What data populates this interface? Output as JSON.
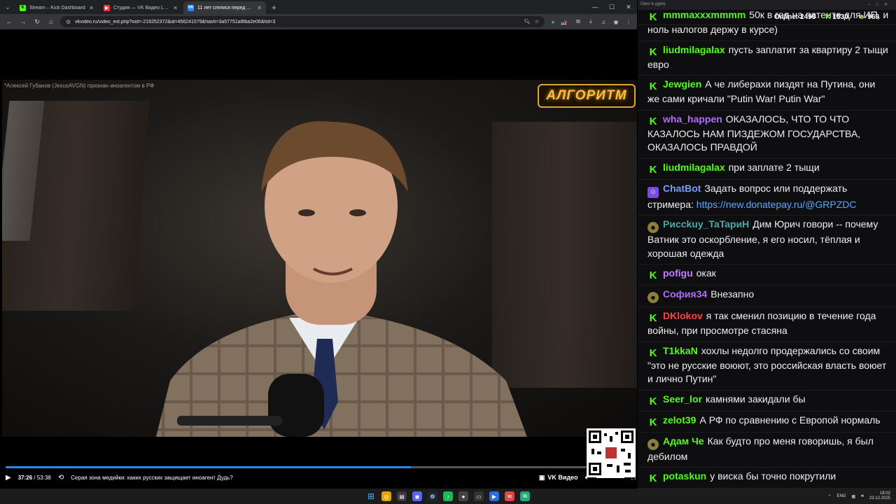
{
  "browser": {
    "tabs": [
      {
        "label": "Stream – Kick Dashboard",
        "color": "#53fc18",
        "glyph": "K"
      },
      {
        "label": "Студия — VK Видео Live",
        "color": "#ff3347",
        "glyph": "V"
      },
      {
        "label": "11 лет сгелися перед Украин",
        "color": "#2787f5",
        "glyph": "VK"
      }
    ],
    "url": "vkvideo.ru/video_ext.php?oid=-219252372&id=456241579&hash=3a57751a9fba2e06&hd=3",
    "ext_badge": "344"
  },
  "video": {
    "notice": "*Алексей Губанов (JesusAVGN) признан иноагентом в РФ",
    "logo": "АЛГОРИТМ",
    "time_current": "37:26",
    "time_total": "53:38",
    "progress": 0.698,
    "title": "Серая зона медийки: каких русских защищает иноагент Дудь?",
    "vk_label": "VK Видео"
  },
  "chat": {
    "window_title": "Окно в дурку",
    "online_label": "Online:",
    "online_count": "2499",
    "kick_count": "1530",
    "other_count": "969",
    "messages": [
      {
        "badge": "k",
        "user": "mmmaxxxmmmm",
        "color": "#53fc18",
        "text": "50к в год на патенте для ИП, и ноль налогов держу в курсе)"
      },
      {
        "badge": "k",
        "user": "liudmilagalax",
        "color": "#53fc18",
        "text": "пусть заплатит за квартиру 2 тыщи евро"
      },
      {
        "badge": "k",
        "user": "Jewgien",
        "color": "#53fc18",
        "text": "А че либерахи пиздят на Путина, они же сами кричали \"Putin War! Putin War\""
      },
      {
        "badge": "k",
        "user": "wha_happen",
        "color": "#b06bff",
        "text": "ОКАЗАЛОСЬ, ЧТО ТО ЧТО КАЗАЛОСЬ НАМ ПИЗДЕЖОМ ГОСУДАРСТВА, ОКАЗАЛОСЬ ПРАВДОЙ"
      },
      {
        "badge": "k",
        "user": "liudmilagalax",
        "color": "#53fc18",
        "text": "при заплате 2 тыщи"
      },
      {
        "badge": "b",
        "user": "ChatBot",
        "color": "#7a9cff",
        "text": "Задать вопрос или поддержать стримера:",
        "link": "https://new.donatepay.ru/@GRPZDC"
      },
      {
        "badge": "e",
        "user": "Pиcckuy_TaTapиH",
        "color": "#4aa8a8",
        "text": "Дим Юрич говори -- почему Ватник это оскорбление, я его носил, тёплая и хорошая одежда"
      },
      {
        "badge": "k",
        "user": "pofigu",
        "color": "#c77dff",
        "text": "окак"
      },
      {
        "badge": "e",
        "user": "София34",
        "color": "#b06bff",
        "text": "Внезапно"
      },
      {
        "badge": "k",
        "user": "DKlokov",
        "color": "#ff4040",
        "text": "я так сменил позицию в течение года войны, при просмотре стасяна"
      },
      {
        "badge": "k",
        "user": "T1kkaN",
        "color": "#53fc18",
        "text": "хохлы недолго продержались со своим \"это не русские воюют, это российская власть воюет и лично Путин\""
      },
      {
        "badge": "k",
        "user": "Seer_lor",
        "color": "#53fc18",
        "text": "камнями закидали бы"
      },
      {
        "badge": "k",
        "user": "zelot39",
        "color": "#53fc18",
        "text": "А РФ по сравнению с Европой нормаль"
      },
      {
        "badge": "e",
        "user": "Адам Че",
        "color": "#53fc18",
        "text": "Как будто про меня говоришь, я был дебилом"
      },
      {
        "badge": "k",
        "user": "potaskun",
        "color": "#53fc18",
        "text": "у виска бы точно покрутили"
      }
    ]
  },
  "taskbar": {
    "lang": "ENG",
    "time": "18:02",
    "date": "23.12.2025"
  },
  "colors": {
    "kick": "#53fc18",
    "vk": "#2787f5"
  }
}
